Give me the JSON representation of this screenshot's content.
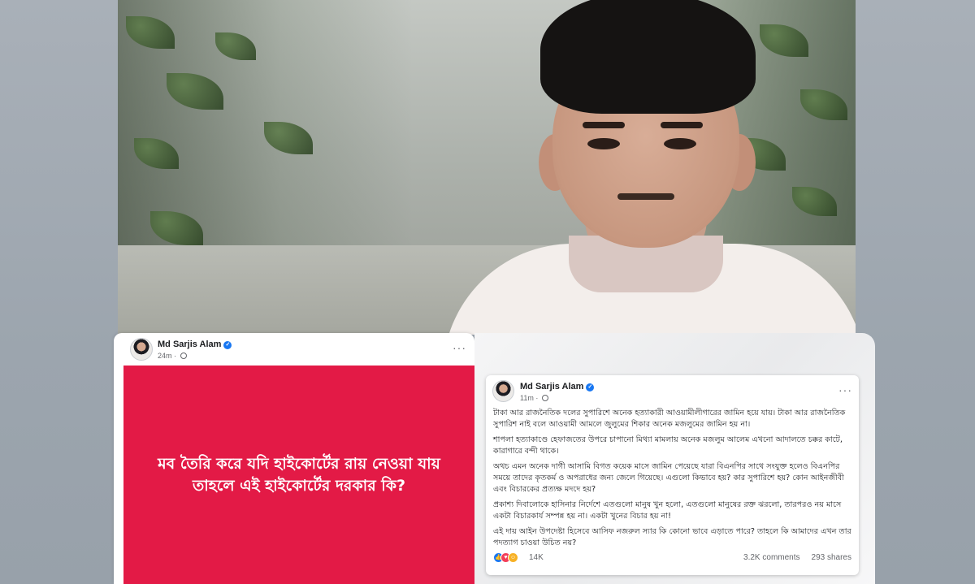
{
  "colors": {
    "card_red": "#e31a46",
    "verified_blue": "#1877f2",
    "meta_gray": "#65676b"
  },
  "left_post": {
    "author": "Md Sarjis Alam",
    "time": "24m",
    "menu": "···",
    "card_text": "মব তৈরি করে যদি হাইকোর্টের রায় নেওয়া যায় তাহলে এই হাইকোর্টের দরকার কি?"
  },
  "right_post": {
    "author": "Md Sarjis Alam",
    "time": "11m",
    "menu": "···",
    "paragraphs": [
      "টাকা আর রাজনৈতিক দলের সুপারিশে অনেক হত্যাকারী আওয়ামীলীগারের জামিন হয়ে যায়। টাকা আর রাজনৈতিক সুপারিশ নাই বলে আওয়ামী আমলে জুলুমের শিকার অনেক মজলুমের জামিন হয় না।",
      "শাপলা হত্যাকাণ্ডে হেফাজতের উপরে চাপানো মিথ্যা মামলায় অনেক মজলুম আলেম এখনো আদালতে চক্কর কাটে, কারাগারে বন্দী থাকে।",
      "অথচ এমন অনেক দাগী আসামি বিগত কয়েক মাসে জামিন পেয়েছে যারা বিএনপির সাথে সংযুক্ত হলেও বিএনপির সময়ে তাদের কৃতকর্ম ও অপরাধের জন্য জেলে গিয়েছে। এগুলো কিভাবে হয়? কার সুপারিশে হয়? কোন আইনজীবী এবং বিচারকের প্রত্যক্ষ মদদে হয়?",
      "প্রকাশ্য দিবালোকে হাসিনার নির্দেশে এতগুলো মানুষ খুন হলো, এতগুলো মানুষের রক্ত ঝরলো, তারপরও নয় মাসে একটা বিচারকার্য সম্পন্ন হয় না। একটা খুনের বিচার হয় না!",
      "এই দায় আইন উপদেষ্টা হিসেবে আসিফ নজরুল স্যার কি কোনো ভাবে এড়াতে পারে? তাহলে কি আমাদের এখন তার পদত্যাগ চাওয়া উচিত নয়?"
    ],
    "reaction_icons": [
      "like-icon",
      "love-icon",
      "haha-icon"
    ],
    "reaction_count": "14K",
    "comments": "3.2K comments",
    "shares": "293 shares"
  }
}
